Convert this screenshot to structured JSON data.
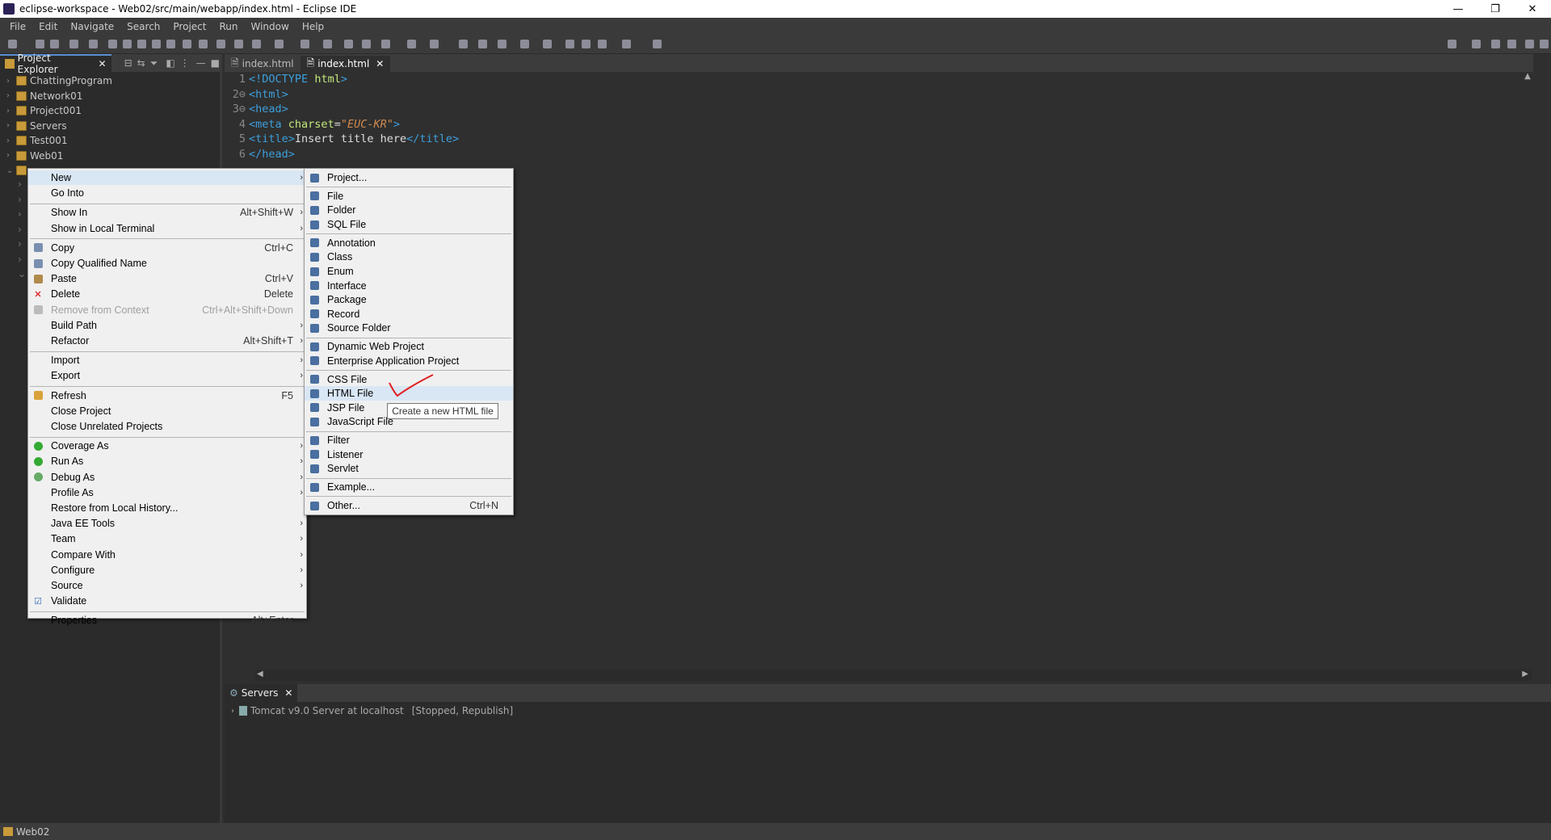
{
  "window": {
    "title": "eclipse-workspace - Web02/src/main/webapp/index.html - Eclipse IDE"
  },
  "menubar": [
    "File",
    "Edit",
    "Navigate",
    "Search",
    "Project",
    "Run",
    "Window",
    "Help"
  ],
  "explorer": {
    "tab_label": "Project Explorer",
    "projects": [
      "ChattingProgram",
      "Network01",
      "Project001",
      "Servers",
      "Test001",
      "Web01"
    ]
  },
  "editor": {
    "tabs": [
      "index.html",
      "index.html"
    ],
    "lines": [
      {
        "n": "1",
        "parts": [
          [
            "tag",
            "<!"
          ],
          [
            "tagn",
            "DOCTYPE"
          ],
          [
            "txt",
            " "
          ],
          [
            "doc",
            "html"
          ],
          [
            "tag",
            ">"
          ]
        ]
      },
      {
        "n": "2⊖",
        "parts": [
          [
            "tag",
            "<"
          ],
          [
            "tagn",
            "html"
          ],
          [
            "tag",
            ">"
          ]
        ]
      },
      {
        "n": "3⊖",
        "parts": [
          [
            "tag",
            "<"
          ],
          [
            "tagn",
            "head"
          ],
          [
            "tag",
            ">"
          ]
        ]
      },
      {
        "n": "4",
        "parts": [
          [
            "tag",
            "<"
          ],
          [
            "tagn",
            "meta"
          ],
          [
            "txt",
            " "
          ],
          [
            "attr",
            "charset"
          ],
          [
            "txt",
            "="
          ],
          [
            "val",
            "\"EUC-KR\""
          ],
          [
            "tag",
            ">"
          ]
        ]
      },
      {
        "n": "5",
        "parts": [
          [
            "tag",
            "<"
          ],
          [
            "tagn",
            "title"
          ],
          [
            "tag",
            ">"
          ],
          [
            "txt",
            "Insert title here"
          ],
          [
            "tag",
            "</"
          ],
          [
            "tagn",
            "title"
          ],
          [
            "tag",
            ">"
          ]
        ]
      },
      {
        "n": "6",
        "parts": [
          [
            "tag",
            "</"
          ],
          [
            "tagn",
            "head"
          ],
          [
            "tag",
            ">"
          ]
        ]
      }
    ]
  },
  "context_menu": {
    "items": [
      {
        "label": "New",
        "arrow": true,
        "hl": true
      },
      {
        "label": "Go Into"
      },
      {
        "sep": true
      },
      {
        "label": "Show In",
        "shortcut": "Alt+Shift+W",
        "arrow": true
      },
      {
        "label": "Show in Local Terminal",
        "arrow": true
      },
      {
        "sep": true
      },
      {
        "label": "Copy",
        "shortcut": "Ctrl+C",
        "icon": "copy-icon"
      },
      {
        "label": "Copy Qualified Name",
        "icon": "copy-icon"
      },
      {
        "label": "Paste",
        "shortcut": "Ctrl+V",
        "icon": "paste-icon"
      },
      {
        "label": "Delete",
        "shortcut": "Delete",
        "icon": "delete-icon"
      },
      {
        "label": "Remove from Context",
        "shortcut": "Ctrl+Alt+Shift+Down",
        "disabled": true,
        "icon": "remove-icon"
      },
      {
        "label": "Build Path",
        "arrow": true
      },
      {
        "label": "Refactor",
        "shortcut": "Alt+Shift+T",
        "arrow": true
      },
      {
        "sep": true
      },
      {
        "label": "Import",
        "arrow": true
      },
      {
        "label": "Export",
        "arrow": true
      },
      {
        "sep": true
      },
      {
        "label": "Refresh",
        "shortcut": "F5",
        "icon": "refresh-icon"
      },
      {
        "label": "Close Project"
      },
      {
        "label": "Close Unrelated Projects"
      },
      {
        "sep": true
      },
      {
        "label": "Coverage As",
        "arrow": true,
        "icon": "coverage-icon"
      },
      {
        "label": "Run As",
        "arrow": true,
        "icon": "run-icon"
      },
      {
        "label": "Debug As",
        "arrow": true,
        "icon": "debug-icon"
      },
      {
        "label": "Profile As",
        "arrow": true
      },
      {
        "label": "Restore from Local History..."
      },
      {
        "label": "Java EE Tools",
        "arrow": true
      },
      {
        "label": "Team",
        "arrow": true
      },
      {
        "label": "Compare With",
        "arrow": true
      },
      {
        "label": "Configure",
        "arrow": true
      },
      {
        "label": "Source",
        "arrow": true
      },
      {
        "label": "Validate",
        "icon": "validate-icon"
      },
      {
        "sep": true
      },
      {
        "label": "Properties",
        "shortcut": "Alt+Enter"
      }
    ]
  },
  "submenu": {
    "items": [
      {
        "label": "Project...",
        "icon": "project-icon"
      },
      {
        "sep": true
      },
      {
        "label": "File",
        "icon": "file-icon"
      },
      {
        "label": "Folder",
        "icon": "folder-icon"
      },
      {
        "label": "SQL File",
        "icon": "sql-file-icon"
      },
      {
        "sep": true
      },
      {
        "label": "Annotation",
        "icon": "annotation-icon"
      },
      {
        "label": "Class",
        "icon": "class-icon"
      },
      {
        "label": "Enum",
        "icon": "enum-icon"
      },
      {
        "label": "Interface",
        "icon": "interface-icon"
      },
      {
        "label": "Package",
        "icon": "package-icon"
      },
      {
        "label": "Record",
        "icon": "record-icon"
      },
      {
        "label": "Source Folder",
        "icon": "source-folder-icon"
      },
      {
        "sep": true
      },
      {
        "label": "Dynamic Web Project",
        "icon": "web-project-icon"
      },
      {
        "label": "Enterprise Application Project",
        "icon": "ear-project-icon"
      },
      {
        "sep": true
      },
      {
        "label": "CSS File",
        "icon": "css-file-icon"
      },
      {
        "label": "HTML File",
        "icon": "html-file-icon",
        "hl": true
      },
      {
        "label": "JSP File",
        "icon": "jsp-file-icon"
      },
      {
        "label": "JavaScript File",
        "icon": "js-file-icon"
      },
      {
        "sep": true
      },
      {
        "label": "Filter",
        "icon": "filter-icon"
      },
      {
        "label": "Listener",
        "icon": "listener-icon"
      },
      {
        "label": "Servlet",
        "icon": "servlet-icon"
      },
      {
        "sep": true
      },
      {
        "label": "Example...",
        "icon": "example-icon"
      },
      {
        "sep": true
      },
      {
        "label": "Other...",
        "shortcut": "Ctrl+N",
        "icon": "other-icon"
      }
    ]
  },
  "tooltip": "Create a new HTML file",
  "servers": {
    "tab_label": "Servers",
    "entry": "Tomcat v9.0 Server at localhost",
    "state": "[Stopped, Republish]"
  },
  "status": {
    "selected": "Web02"
  },
  "colors": {
    "accent": "#5a8fd1",
    "annotation_mark": "#e02020"
  }
}
